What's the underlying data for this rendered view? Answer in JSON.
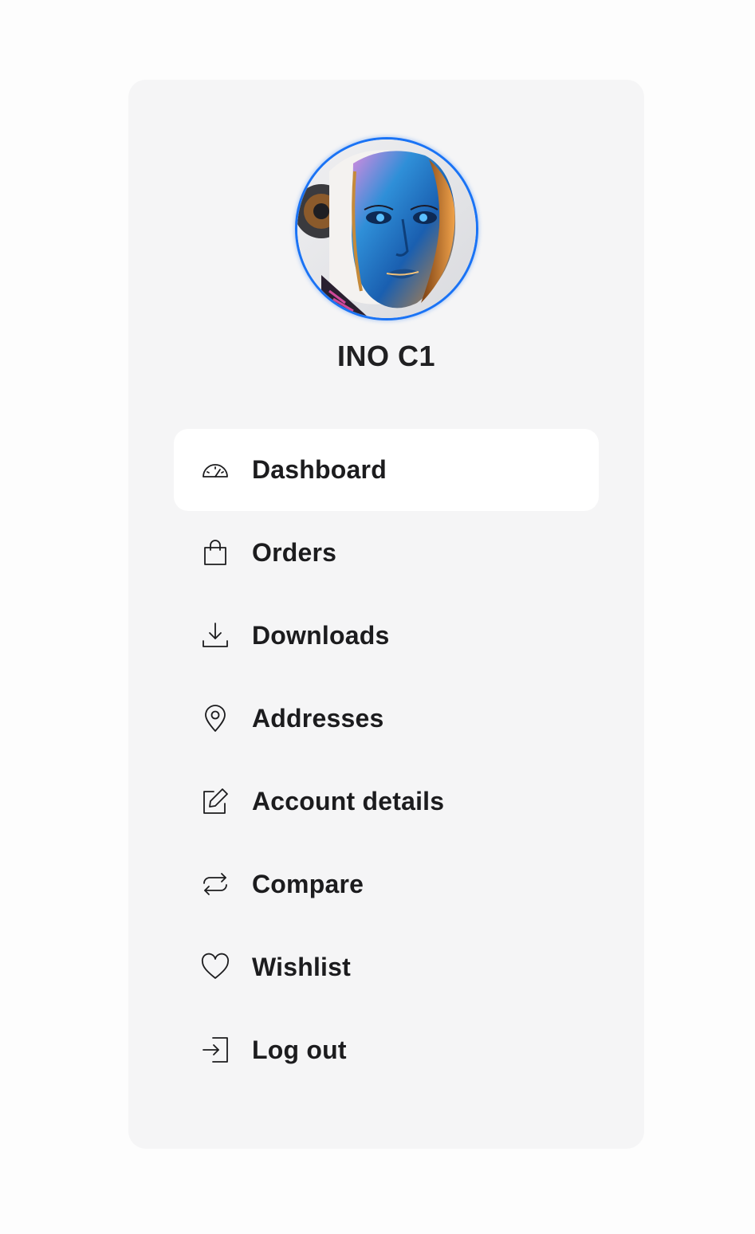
{
  "user": {
    "name": "INO C1",
    "avatar_icon": "robot-avatar-image",
    "avatar_border_color": "#1a73f5"
  },
  "nav": {
    "active": "Dashboard",
    "items": [
      {
        "label": "Dashboard",
        "icon": "speedometer-icon"
      },
      {
        "label": "Orders",
        "icon": "shopping-bag-icon"
      },
      {
        "label": "Downloads",
        "icon": "download-icon"
      },
      {
        "label": "Addresses",
        "icon": "location-pin-icon"
      },
      {
        "label": "Account details",
        "icon": "edit-icon"
      },
      {
        "label": "Compare",
        "icon": "compare-arrows-icon"
      },
      {
        "label": "Wishlist",
        "icon": "heart-icon"
      },
      {
        "label": "Log out",
        "icon": "logout-icon"
      }
    ]
  },
  "colors": {
    "panel_background": "#f5f5f6",
    "active_item_background": "#ffffff",
    "text": "#1c1c1e"
  }
}
